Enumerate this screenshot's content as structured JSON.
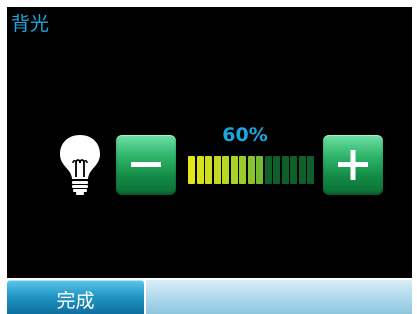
{
  "screen": {
    "title": "背光"
  },
  "backlight": {
    "percent_label": "60%",
    "level": 0.6,
    "segments_total": 15,
    "segments_lit": 9,
    "lit_colors": [
      "#e4e61a",
      "#d9e11c",
      "#cfde1f",
      "#c4da22",
      "#b8d624",
      "#aad228",
      "#9acc2b",
      "#88c42e",
      "#74bb30"
    ],
    "unlit_color": "#0f5f2a"
  },
  "controls": {
    "minus_icon": "minus-icon",
    "plus_icon": "plus-icon",
    "bulb_icon": "lightbulb-icon"
  },
  "footer": {
    "done_label": "完成"
  },
  "colors": {
    "accent": "#1aa6e0",
    "button_green": "#1f9a55",
    "background": "#000000"
  }
}
